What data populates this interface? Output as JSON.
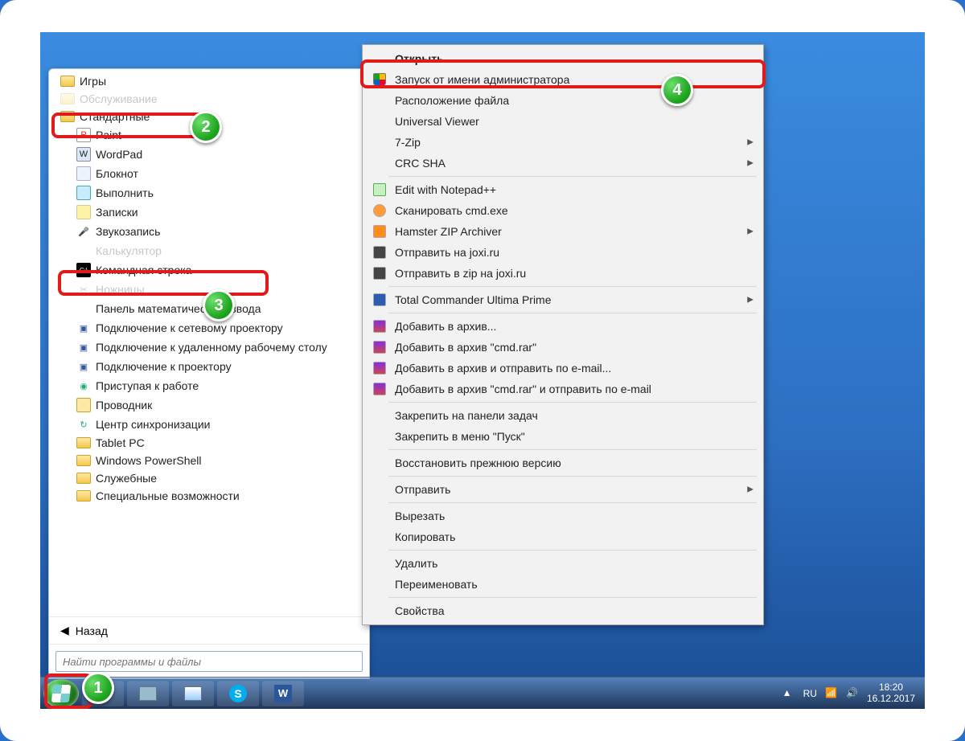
{
  "annotations": {
    "b1": "1",
    "b2": "2",
    "b3": "3",
    "b4": "4"
  },
  "startmenu": {
    "folders_top": [
      {
        "label": "Игры"
      },
      {
        "label": "Обслуживание"
      }
    ],
    "standard_label": "Стандартные",
    "apps": [
      {
        "label": "Paint",
        "icon": "paint"
      },
      {
        "label": "WordPad",
        "icon": "wordpad"
      },
      {
        "label": "Блокнот",
        "icon": "notepad"
      },
      {
        "label": "Выполнить",
        "icon": "run"
      },
      {
        "label": "Записки",
        "icon": "notes"
      },
      {
        "label": "Звукозапись",
        "icon": "mic"
      },
      {
        "label": "Калькулятор",
        "icon": "app-icon"
      }
    ],
    "cmd_label": "Командная строка",
    "apps2": [
      {
        "label": "Ножницы",
        "icon": "app-icon"
      },
      {
        "label": "Панель математического ввода",
        "icon": "app-icon"
      },
      {
        "label": "Подключение к сетевому проектору",
        "icon": "proj"
      },
      {
        "label": "Подключение к удаленному рабочему столу",
        "icon": "proj"
      },
      {
        "label": "Подключение к проектору",
        "icon": "proj"
      },
      {
        "label": "Приступая к работе",
        "icon": "globe"
      },
      {
        "label": "Проводник",
        "icon": "explorer"
      },
      {
        "label": "Центр синхронизации",
        "icon": "sync"
      }
    ],
    "folders_bottom": [
      {
        "label": "Tablet PC"
      },
      {
        "label": "Windows PowerShell"
      },
      {
        "label": "Служебные"
      },
      {
        "label": "Специальные возможности"
      }
    ],
    "back": "Назад",
    "search_placeholder": "Найти программы и файлы"
  },
  "ctx": {
    "open": "Открыть",
    "run_admin": "Запуск от имени администратора",
    "file_location": "Расположение файла",
    "uv": "Universal Viewer",
    "sevenzip": "7-Zip",
    "crc": "CRC SHA",
    "npp": "Edit with Notepad++",
    "scan": "Сканировать cmd.exe",
    "hamster": "Hamster ZIP Archiver",
    "joxi1": "Отправить на joxi.ru",
    "joxi2": "Отправить в zip на joxi.ru",
    "tc": "Total Commander Ultima Prime",
    "rar1": "Добавить в архив...",
    "rar2": "Добавить в архив \"cmd.rar\"",
    "rar3": "Добавить в архив и отправить по e-mail...",
    "rar4": "Добавить в архив \"cmd.rar\" и отправить по e-mail",
    "pin_tb": "Закрепить на панели задач",
    "pin_start": "Закрепить в меню \"Пуск\"",
    "restore": "Восстановить прежнюю версию",
    "sendto": "Отправить",
    "cut": "Вырезать",
    "copy": "Копировать",
    "delete": "Удалить",
    "rename": "Переименовать",
    "props": "Свойства"
  },
  "taskbar": {
    "time": "18:20",
    "date": "16.12.2017",
    "lang": "RU"
  }
}
